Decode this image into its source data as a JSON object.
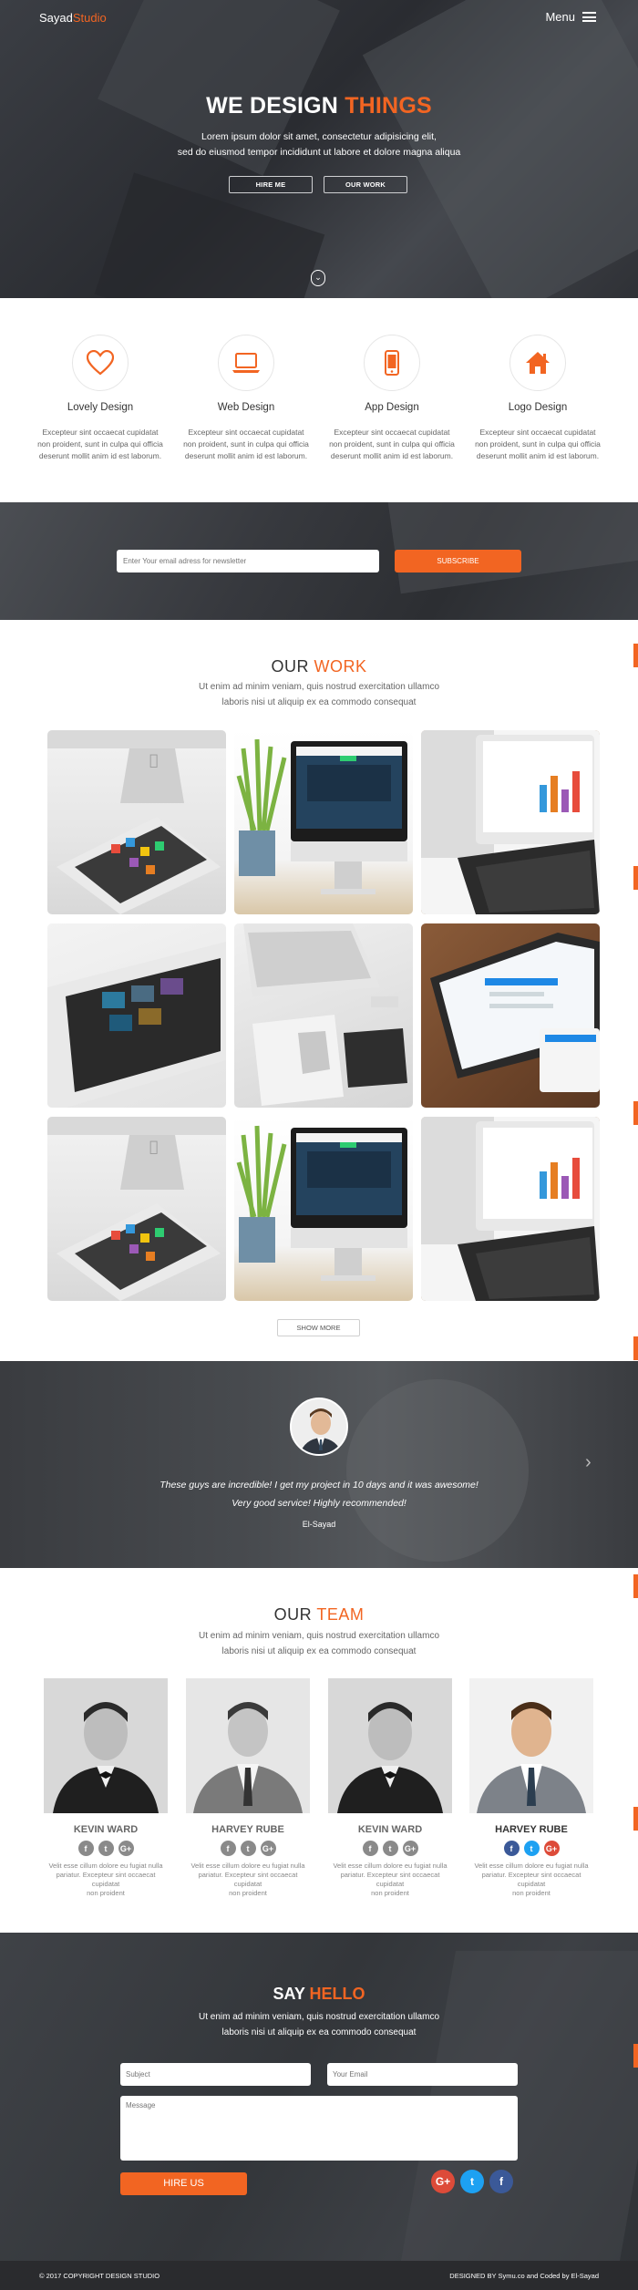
{
  "header": {
    "logo_main": "Sayad",
    "logo_accent": "Studio",
    "menu_label": "Menu"
  },
  "hero": {
    "title_main": "WE DESIGN",
    "title_accent": "THINGS",
    "subtitle_line1": "Lorem ipsum dolor sit amet, consectetur adipisicing elit,",
    "subtitle_line2": "sed do eiusmod tempor incididunt ut labore et dolore magna aliqua",
    "button_hire": "HIRE ME",
    "button_work": "OUR WORK"
  },
  "services": [
    {
      "title": "Lovely Design",
      "icon": "heart-icon",
      "text_line1": "Excepteur sint occaecat cupidatat",
      "text_line2": "non proident, sunt in culpa qui officia",
      "text_line3": "deserunt mollit anim id est laborum."
    },
    {
      "title": "Web Design",
      "icon": "laptop-icon",
      "text_line1": "Excepteur sint occaecat cupidatat",
      "text_line2": "non proident, sunt in culpa qui officia",
      "text_line3": "deserunt mollit anim id est laborum."
    },
    {
      "title": "App Design",
      "icon": "mobile-icon",
      "text_line1": "Excepteur sint occaecat cupidatat",
      "text_line2": "non proident, sunt in culpa qui officia",
      "text_line3": "deserunt mollit anim id est laborum."
    },
    {
      "title": "Logo Design",
      "icon": "home-icon",
      "text_line1": "Excepteur sint occaecat cupidatat",
      "text_line2": "non proident, sunt in culpa qui officia",
      "text_line3": "deserunt mollit anim id est laborum."
    }
  ],
  "newsletter": {
    "placeholder": "Enter Your email adress for newsletter",
    "button": "SUBSCRIBE"
  },
  "work": {
    "title_main": "OUR",
    "title_accent": "WORK",
    "subtitle_line1": "Ut enim ad minim veniam, quis nostrud exercitation ullamco",
    "subtitle_line2": "laboris nisi ut aliquip ex ea commodo consequat",
    "show_more": "SHOW MORE"
  },
  "testimonial": {
    "quote_line1": "These guys are incredible! I get my project in 10 days and it was awesome!",
    "quote_line2": "Very good service! Highly recommended!",
    "author": "El-Sayad"
  },
  "team": {
    "title_main": "OUR",
    "title_accent": "TEAM",
    "subtitle_line1": "Ut enim ad minim veniam, quis nostrud exercitation ullamco",
    "subtitle_line2": "laboris nisi ut aliquip ex ea commodo consequat",
    "members": [
      {
        "name": "KEVIN WARD",
        "text_line1": "Velit esse cillum dolore eu fugiat nulla",
        "text_line2": "pariatur. Excepteur sint occaecat cupidatat",
        "text_line3": "non proident"
      },
      {
        "name": "HARVEY RUBE",
        "text_line1": "Velit esse cillum dolore eu fugiat nulla",
        "text_line2": "pariatur. Excepteur sint occaecat cupidatat",
        "text_line3": "non proident"
      },
      {
        "name": "KEVIN WARD",
        "text_line1": "Velit esse cillum dolore eu fugiat nulla",
        "text_line2": "pariatur. Excepteur sint occaecat cupidatat",
        "text_line3": "non proident"
      },
      {
        "name": "HARVEY RUBE",
        "text_line1": "Velit esse cillum dolore eu fugiat nulla",
        "text_line2": "pariatur. Excepteur sint occaecat cupidatat",
        "text_line3": "non proident"
      }
    ]
  },
  "contact": {
    "title_main": "SAY",
    "title_accent": "HELLO",
    "subtitle_line1": "Ut enim ad minim veniam, quis nostrud exercitation ullamco",
    "subtitle_line2": "laboris nisi ut aliquip ex ea commodo consequat",
    "subject_placeholder": "Subject",
    "email_placeholder": "Your Email",
    "message_placeholder": "Message",
    "button": "HIRE US"
  },
  "footer": {
    "copyright": "© 2017 COPYRIGHT DESIGN STUDIO",
    "credit": "DESIGNED BY Symu.co and Coded by El-Sayad"
  },
  "colors": {
    "accent": "#f26522",
    "dark_bg": "#2a2b2e",
    "facebook": "#3b5998",
    "twitter": "#1da1f2",
    "google_plus": "#dd4b39"
  }
}
